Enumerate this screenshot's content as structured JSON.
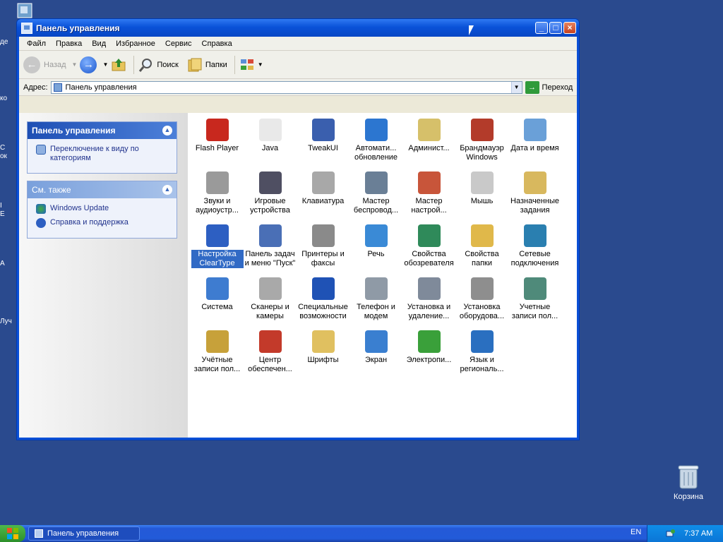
{
  "desktop": {
    "left_fragments": [
      "де",
      "ко",
      "С",
      "ок",
      "I",
      "Е",
      "А",
      "Луч"
    ],
    "recycle_bin_label": "Корзина"
  },
  "window": {
    "title": "Панель управления",
    "menu": [
      "Файл",
      "Правка",
      "Вид",
      "Избранное",
      "Сервис",
      "Справка"
    ],
    "toolbar": {
      "back": "Назад",
      "search": "Поиск",
      "folders": "Папки"
    },
    "address": {
      "label": "Адрес:",
      "value": "Панель управления",
      "go": "Переход"
    },
    "taskpane": {
      "panel1_title": "Панель управления",
      "panel1_link": "Переключение к виду по категориям",
      "panel2_title": "См. также",
      "panel2_links": [
        "Windows Update",
        "Справка и поддержка"
      ]
    },
    "items": [
      {
        "label": "Flash Player",
        "icon": "flash-icon",
        "color": "#c8281e"
      },
      {
        "label": "Java",
        "icon": "java-icon",
        "color": "#e9e9e9"
      },
      {
        "label": "TweakUI",
        "icon": "tweakui-icon",
        "color": "#3a5fae"
      },
      {
        "label": "Автомати... обновление",
        "icon": "windows-update-icon",
        "color": "#2c76d0"
      },
      {
        "label": "Админист...",
        "icon": "admin-tools-icon",
        "color": "#d6c06a"
      },
      {
        "label": "Брандмауэр Windows",
        "icon": "firewall-icon",
        "color": "#b33b2a"
      },
      {
        "label": "Дата и время",
        "icon": "clock-icon",
        "color": "#6aa0d8"
      },
      {
        "label": "Звуки и аудиоустр...",
        "icon": "speaker-icon",
        "color": "#9a9a9a"
      },
      {
        "label": "Игровые устройства",
        "icon": "gamepad-icon",
        "color": "#4f4f62"
      },
      {
        "label": "Клавиатура",
        "icon": "keyboard-icon",
        "color": "#a8a8a8"
      },
      {
        "label": "Мастер беспровод...",
        "icon": "wireless-icon",
        "color": "#6a7f96"
      },
      {
        "label": "Мастер настрой...",
        "icon": "home-network-icon",
        "color": "#c8553a"
      },
      {
        "label": "Мышь",
        "icon": "mouse-icon",
        "color": "#c9c9c9"
      },
      {
        "label": "Назначенные задания",
        "icon": "scheduled-tasks-icon",
        "color": "#d8b85e"
      },
      {
        "label": "Настройка ClearType",
        "icon": "cleartype-icon",
        "color": "#2d5fc2"
      },
      {
        "label": "Панель задач и меню \"Пуск\"",
        "icon": "taskbar-icon",
        "color": "#4a6fb6"
      },
      {
        "label": "Принтеры и факсы",
        "icon": "printer-icon",
        "color": "#8a8a8a"
      },
      {
        "label": "Речь",
        "icon": "speech-icon",
        "color": "#3a8ad6"
      },
      {
        "label": "Свойства обозревателя",
        "icon": "internet-options-icon",
        "color": "#2f8a5a"
      },
      {
        "label": "Свойства папки",
        "icon": "folder-options-icon",
        "color": "#e0b84a"
      },
      {
        "label": "Сетевые подключения",
        "icon": "network-connections-icon",
        "color": "#2a7fb0"
      },
      {
        "label": "Система",
        "icon": "system-icon",
        "color": "#3e7cd0"
      },
      {
        "label": "Сканеры и камеры",
        "icon": "scanner-camera-icon",
        "color": "#a9a9a9"
      },
      {
        "label": "Специальные возможности",
        "icon": "accessibility-icon",
        "color": "#1f52b5"
      },
      {
        "label": "Телефон и модем",
        "icon": "phone-modem-icon",
        "color": "#8f9aa6"
      },
      {
        "label": "Установка и удаление...",
        "icon": "add-remove-programs-icon",
        "color": "#7f8a9a"
      },
      {
        "label": "Установка оборудова...",
        "icon": "add-hardware-icon",
        "color": "#8e8e8e"
      },
      {
        "label": "Учетные записи пол...",
        "icon": "user-accounts-icon",
        "color": "#4f8a7a"
      },
      {
        "label": "Учётные записи пол...",
        "icon": "lock-icon",
        "color": "#c7a13a"
      },
      {
        "label": "Центр обеспечен...",
        "icon": "security-center-icon",
        "color": "#c33a2a"
      },
      {
        "label": "Шрифты",
        "icon": "fonts-icon",
        "color": "#e0c060"
      },
      {
        "label": "Экран",
        "icon": "display-icon",
        "color": "#3a7fd0"
      },
      {
        "label": "Электропи...",
        "icon": "power-options-icon",
        "color": "#3aa03a"
      },
      {
        "label": "Язык и региональ...",
        "icon": "regional-settings-icon",
        "color": "#2a6fc0"
      }
    ],
    "selected_index": 14
  },
  "taskbar": {
    "active_window": "Панель управления",
    "language": "EN",
    "time": "7:37 AM"
  }
}
